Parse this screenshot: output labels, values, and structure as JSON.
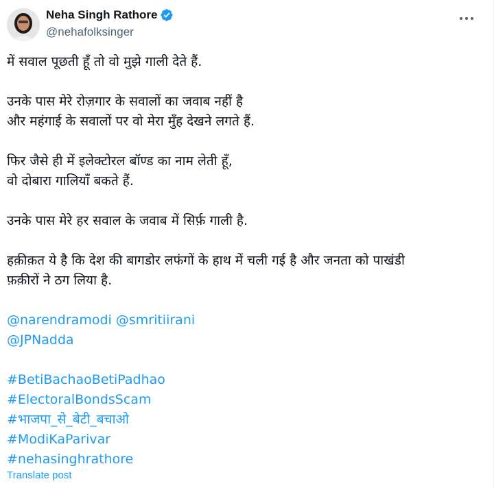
{
  "author": {
    "name": "Neha Singh Rathore",
    "handle": "@nehafolksinger",
    "verified": true
  },
  "post": {
    "lines": [
      "में सवाल पूछती हूँ तो वो मुझे गाली देते हैं.",
      "",
      "उनके पास मेरे रोज़गार के सवालों का जवाब नहीं है",
      "और महंगाई के सवालों पर वो मेरा मुँह देखने लगते हैं.",
      "",
      "फिर जैसे ही में इलेक्टोरल बॉण्ड का नाम लेती हूँ,",
      "वो दोबारा गालियाँ बकते हैं.",
      "",
      "उनके पास मेरे हर सवाल के जवाब में सिर्फ़ गाली है.",
      "",
      "हक़ीक़त ये है कि देश की बागडोर लफंगों के हाथ में चली गई है और जनता को पाखंडी",
      "फ़क़ीरों ने ठग लिया है."
    ],
    "mentions_line1": [
      "@narendramodi",
      "@smritiirani"
    ],
    "mentions_line2": [
      "@JPNadda"
    ],
    "hashtags": [
      "#BetiBachaoBetiPadhao",
      "#ElectoralBondsScam",
      "#भाजपा_से_बेटी_बचाओ",
      "#ModiKaParivar",
      "#nehasinghrathore"
    ],
    "translate_label": "Translate post"
  },
  "colors": {
    "link": "#1d9bf0",
    "text": "#0f1419",
    "secondary": "#536471"
  },
  "icons": {
    "verified": "verified-badge-icon",
    "more": "more-options-icon"
  }
}
